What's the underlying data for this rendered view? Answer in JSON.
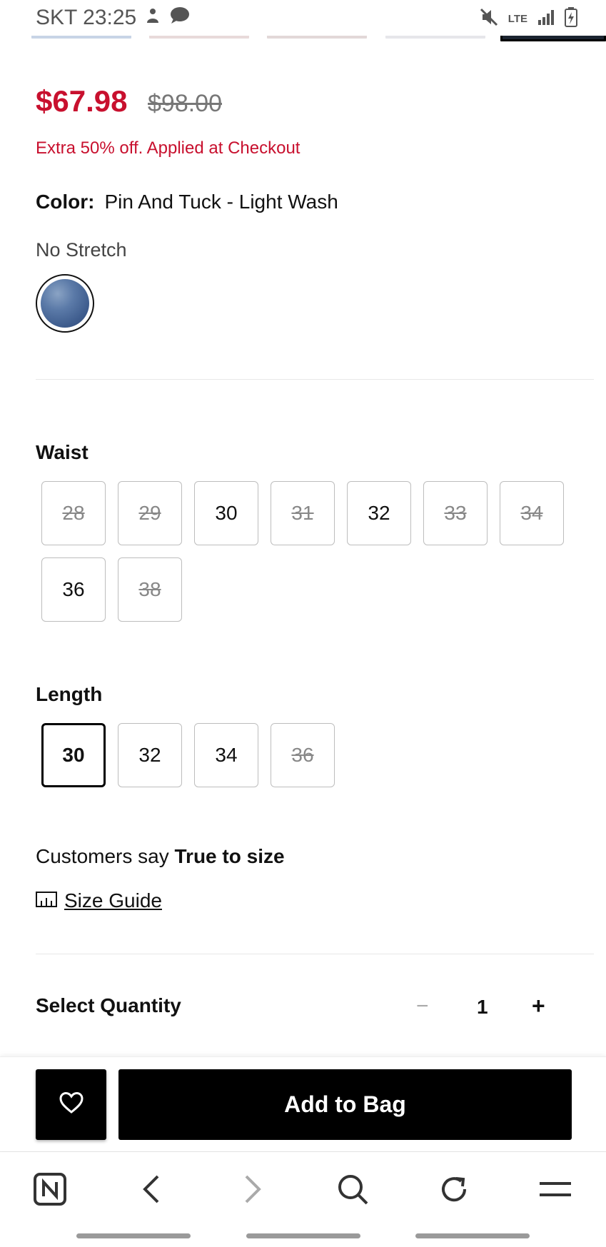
{
  "status_bar": {
    "carrier_time": "SKT 23:25",
    "network": "LTE"
  },
  "product": {
    "price": "$67.98",
    "original_price": "$98.00",
    "promo": "Extra 50% off. Applied at Checkout",
    "color_label": "Color:",
    "color_value": "Pin And Tuck - Light Wash",
    "stretch": "No Stretch"
  },
  "waist": {
    "title": "Waist",
    "sizes": [
      {
        "label": "28",
        "available": false
      },
      {
        "label": "29",
        "available": false
      },
      {
        "label": "30",
        "available": true
      },
      {
        "label": "31",
        "available": false
      },
      {
        "label": "32",
        "available": true
      },
      {
        "label": "33",
        "available": false
      },
      {
        "label": "34",
        "available": false
      },
      {
        "label": "36",
        "available": true
      },
      {
        "label": "38",
        "available": false
      }
    ]
  },
  "length": {
    "title": "Length",
    "sizes": [
      {
        "label": "30",
        "available": true,
        "selected": true
      },
      {
        "label": "32",
        "available": true
      },
      {
        "label": "34",
        "available": true
      },
      {
        "label": "36",
        "available": false
      }
    ]
  },
  "fit": {
    "prefix": "Customers say",
    "value": "True to size",
    "size_guide": "Size Guide"
  },
  "quantity": {
    "title": "Select Quantity",
    "minus": "−",
    "value": "1",
    "plus": "+"
  },
  "actions": {
    "add_to_bag": "Add to Bag",
    "wishlist_icon": "heart-icon"
  },
  "browser_nav": {
    "icons": [
      "home-n-icon",
      "back-icon",
      "forward-icon",
      "search-icon",
      "refresh-icon",
      "menu-icon"
    ]
  },
  "colors": {
    "sale_red": "#c8102e",
    "black": "#000000"
  }
}
